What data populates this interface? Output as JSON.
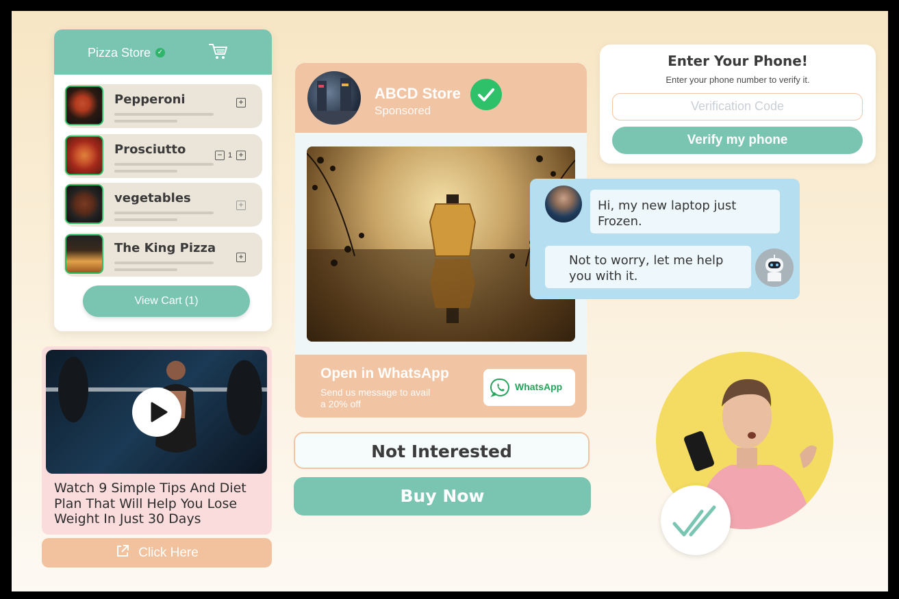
{
  "pizza_store": {
    "title": "Pizza Store",
    "items": [
      {
        "name": "Pepperoni",
        "quantity": null
      },
      {
        "name": "Prosciutto",
        "quantity": "1"
      },
      {
        "name": "vegetables",
        "quantity": null
      },
      {
        "name": "The King Pizza",
        "quantity": null
      }
    ],
    "view_cart_label": "View Cart (1)"
  },
  "video": {
    "caption": "Watch 9 Simple Tips And Diet Plan That Will Help You Lose Weight In Just 30 Days",
    "click_here_label": "Click Here"
  },
  "ad": {
    "store_name": "ABCD Store",
    "sponsored_label": "Sponsored",
    "whatsapp_title": "Open in WhatsApp",
    "whatsapp_subtitle": "Send us message to avail a 20% off",
    "whatsapp_button_label": "WhatsApp"
  },
  "actions": {
    "not_interested_label": "Not Interested",
    "buy_now_label": "Buy Now"
  },
  "phone_verify": {
    "title": "Enter Your Phone!",
    "subtitle": "Enter your phone number to verify it.",
    "input_placeholder": "Verification Code",
    "verify_button_label": "Verify my phone"
  },
  "chat": {
    "messages": [
      {
        "from": "user",
        "text": "Hi, my new laptop just Frozen."
      },
      {
        "from": "bot",
        "text": "Not to worry, let me help you with it."
      }
    ]
  },
  "colors": {
    "accent_teal": "#79c5b2",
    "peach": "#f1c4a3",
    "verified_green": "#2fc06a",
    "chat_blue": "#b5dff0",
    "yellow": "#f4dc62"
  }
}
